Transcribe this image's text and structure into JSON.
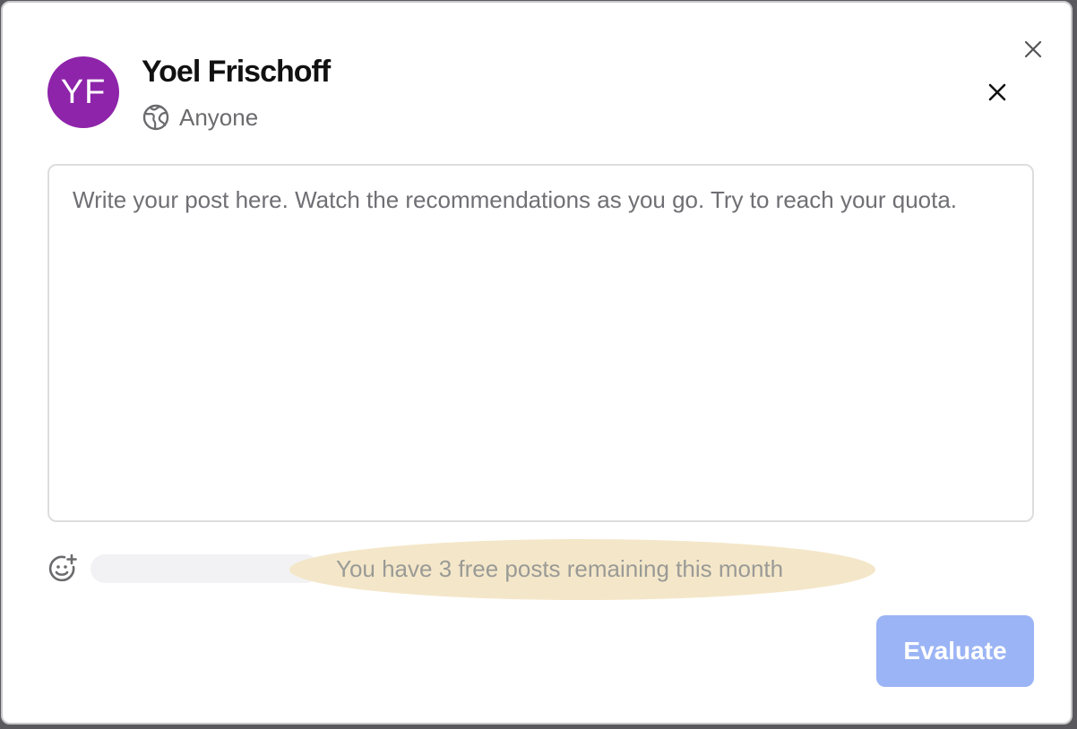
{
  "colors": {
    "avatar_bg": "#8e24aa",
    "evaluate_bg": "#9bb4f5",
    "quota_highlight": "#f3e6c6"
  },
  "user": {
    "initials": "YF",
    "name": "Yoel Frischoff"
  },
  "audience": {
    "icon": "globe-icon",
    "label": "Anyone"
  },
  "post": {
    "placeholder": "Write your post here. Watch the recommendations as you go. Try to reach your quota."
  },
  "footer": {
    "emoji_icon": "emoji-add-icon",
    "quota_text": "You have 3 free posts remaining this month",
    "evaluate_label": "Evaluate",
    "evaluate_enabled": false
  },
  "icons": {
    "close_outer": "close-icon",
    "close_inner": "close-icon"
  }
}
